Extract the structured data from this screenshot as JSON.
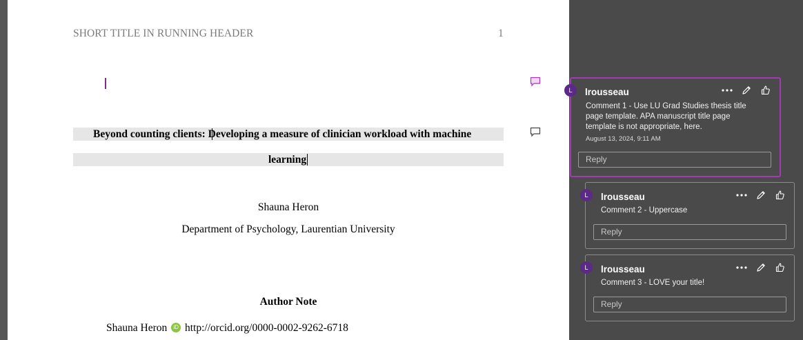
{
  "document": {
    "running_header": "SHORT TITLE IN RUNNING HEADER",
    "page_number": "1",
    "title_line1": "Beyond counting clients: Developing a measure of clinician workload with machine",
    "title_line2": "learning",
    "author_name": "Shauna Heron",
    "affiliation": "Department of Psychology, Laurentian University",
    "author_note_heading": "Author Note",
    "orcid_author": "Shauna Heron",
    "orcid_badge": "iD",
    "orcid_url": "http://orcid.org/0000-0002-9262-6718"
  },
  "comments": [
    {
      "avatar_initial": "L",
      "author": "lrousseau",
      "text": "Comment 1 - Use LU Grad Studies thesis title page template. APA manuscript title page template is not appropriate, here.",
      "date": "August 13, 2024, 9:11 AM",
      "reply_placeholder": "Reply"
    },
    {
      "avatar_initial": "L",
      "author": "lrousseau",
      "text": "Comment 2 - Uppercase",
      "reply_placeholder": "Reply"
    },
    {
      "avatar_initial": "L",
      "author": "lrousseau",
      "text": "Comment 3 - LOVE your title!",
      "reply_placeholder": "Reply"
    }
  ],
  "colors": {
    "active_border": "#a33bb3",
    "avatar": "#5b2a86",
    "pane_bg": "#4a4a4a",
    "title_highlight": "#e6e6e6"
  },
  "icons": [
    "more-options-icon",
    "edit-pencil-icon",
    "like-thumb-icon",
    "comment-bubble-icon",
    "orcid-icon"
  ]
}
